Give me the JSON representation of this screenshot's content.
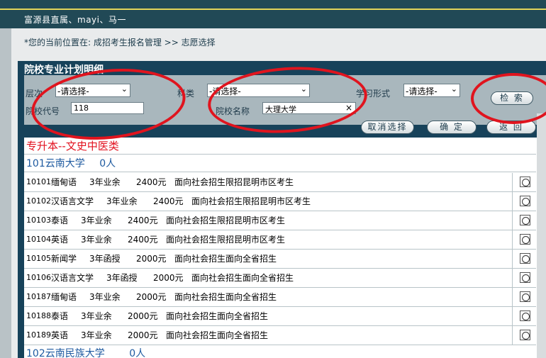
{
  "header": {
    "user_text": "富源县直属、mayi、马一"
  },
  "breadcrumb": {
    "text": "*您的当前位置在: 成招考生报名管理 >> 志愿选择"
  },
  "panel": {
    "title": "院校专业计划明细"
  },
  "filters": {
    "level_label": "层次",
    "level_value": "-请选择-",
    "subject_label": "科类",
    "subject_value": "-请选择-",
    "study_label": "学习形式",
    "study_value": "-请选择-",
    "school_code_label": "院校代号",
    "school_code_value": "118",
    "school_name_label": "院校名称",
    "school_name_value": "大理大学",
    "search_button": "检 索",
    "cancel_button": "取消选择",
    "confirm_button": "确 定",
    "back_button": "返 回"
  },
  "category": "专升本--文史中医类",
  "schools": [
    {
      "name": "101云南大学",
      "count": "0人"
    },
    {
      "name": "102云南民族大学",
      "count": "0人"
    }
  ],
  "rows": [
    {
      "code": "10101",
      "major": "缅甸语",
      "years": "3年业余",
      "fee": "2400元",
      "note": "面向社会招生限招昆明市区考生"
    },
    {
      "code": "10102",
      "major": "汉语言文学",
      "years": "3年业余",
      "fee": "2400元",
      "note": "面向社会招生限招昆明市区考生"
    },
    {
      "code": "10103",
      "major": "泰语",
      "years": "3年业余",
      "fee": "2400元",
      "note": "面向社会招生限招昆明市区考生"
    },
    {
      "code": "10104",
      "major": "英语",
      "years": "3年业余",
      "fee": "2400元",
      "note": "面向社会招生限招昆明市区考生"
    },
    {
      "code": "10105",
      "major": "新闻学",
      "years": "3年函授",
      "fee": "2000元",
      "note": "面向社会招生面向全省招生"
    },
    {
      "code": "10106",
      "major": "汉语言文学",
      "years": "3年函授",
      "fee": "2000元",
      "note": "面向社会招生面向全省招生"
    },
    {
      "code": "10187",
      "major": "缅甸语",
      "years": "3年业余",
      "fee": "2000元",
      "note": "面向社会招生面向全省招生"
    },
    {
      "code": "10188",
      "major": "泰语",
      "years": "3年业余",
      "fee": "2000元",
      "note": "面向社会招生面向全省招生"
    },
    {
      "code": "10189",
      "major": "英语",
      "years": "3年业余",
      "fee": "2000元",
      "note": "面向社会招生面向全省招生"
    }
  ],
  "colors": {
    "header_bg": "#214956",
    "panel_bg": "#17425a",
    "category_red": "#e2121f",
    "school_blue": "#1e5aa0",
    "annotation_red": "#e0141e"
  }
}
